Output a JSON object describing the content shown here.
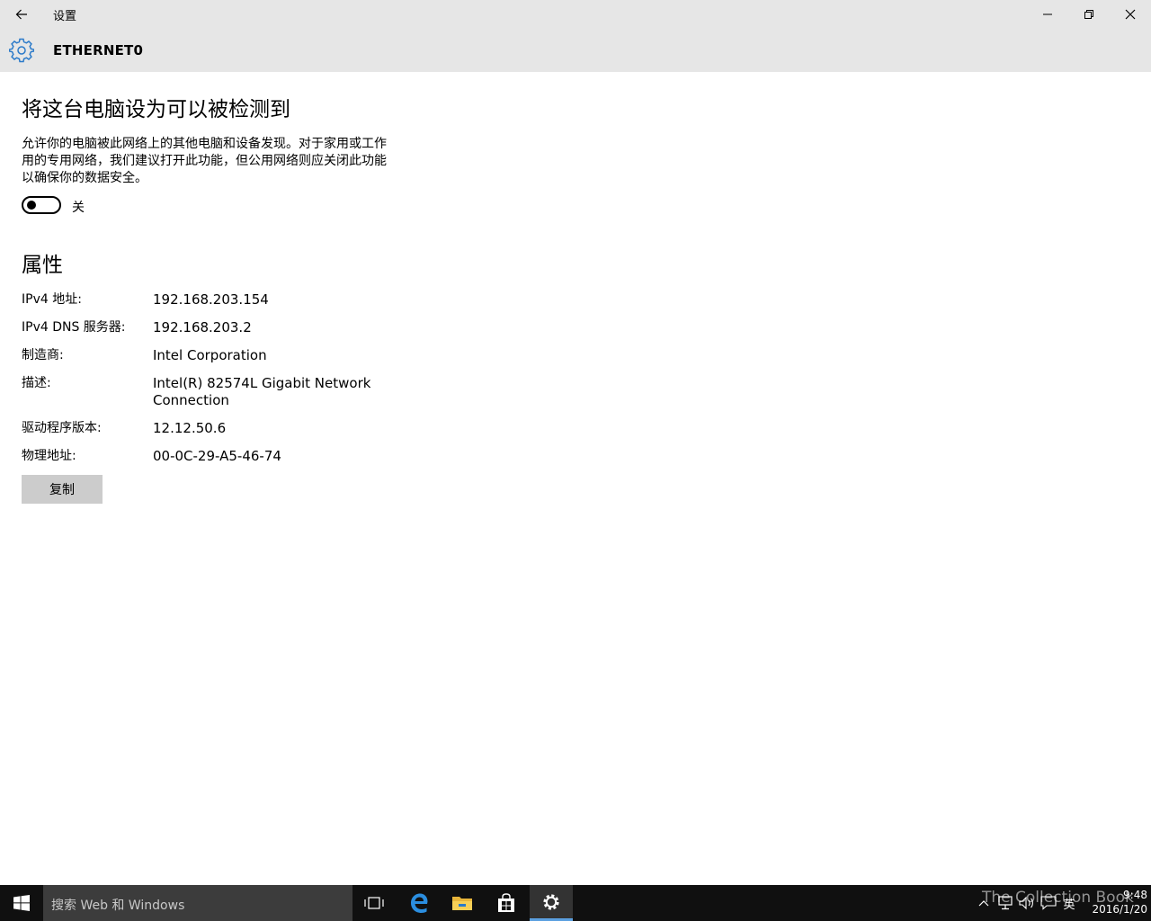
{
  "window": {
    "app_title": "设置",
    "page_title": "ETHERNET0"
  },
  "discover": {
    "title": "将这台电脑设为可以被检测到",
    "description_lines": [
      "允许你的电脑被此网络上的其他电脑和设备发现。对于家用或工作",
      "用的专用网络，我们建议打开此功能，但公用网络则应关闭此功能",
      "以确保你的数据安全。"
    ],
    "toggle_state": "关",
    "toggle_on": false
  },
  "properties": {
    "title": "属性",
    "rows": [
      {
        "label": "IPv4 地址:",
        "value": "192.168.203.154"
      },
      {
        "label": "IPv4 DNS 服务器:",
        "value": "192.168.203.2"
      },
      {
        "label": "制造商:",
        "value": "Intel Corporation"
      },
      {
        "label": "描述:",
        "value_lines": [
          "Intel(R) 82574L Gigabit Network",
          "Connection"
        ]
      },
      {
        "label": "驱动程序版本:",
        "value": "12.12.50.6"
      },
      {
        "label": "物理地址:",
        "value": "00-0C-29-A5-46-74"
      }
    ],
    "copy_label": "复制"
  },
  "taskbar": {
    "search_placeholder": "搜索 Web 和 Windows",
    "ime_indicator": "英",
    "time": "9:48",
    "date": "2016/1/20",
    "watermark": "The Collection Book"
  },
  "colors": {
    "chrome_bg": "#e6e6e6",
    "accent": "#2b7ac9",
    "taskbar_bg": "#101010",
    "button_bg": "#cccccc"
  },
  "icons": {
    "back": "back-arrow-icon",
    "settings": "gear-icon",
    "minimize": "minimize-icon",
    "maximize": "restore-icon",
    "close": "close-icon",
    "start": "windows-logo-icon",
    "task_view": "task-view-icon",
    "edge": "edge-browser-icon",
    "explorer": "file-explorer-icon",
    "store": "store-icon",
    "settings_app": "settings-app-icon"
  }
}
